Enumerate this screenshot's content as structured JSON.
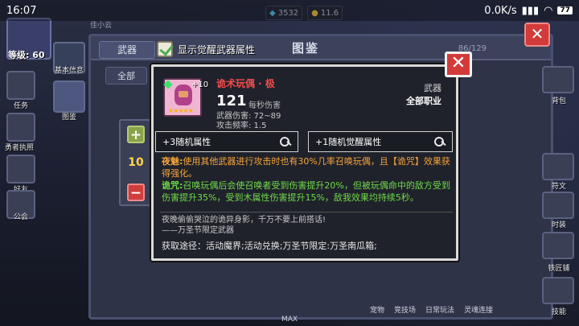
{
  "status_bar": {
    "time": "16:07",
    "network_speed": "0.0K/s",
    "battery": "77"
  },
  "hud": {
    "level_label": "等级: 60",
    "player_name": "佳小云",
    "gem_count": "3532",
    "coin_count": "11.6"
  },
  "left_nav": {
    "items": [
      {
        "label": "任务"
      },
      {
        "label": "勇者执照"
      },
      {
        "label": "好友"
      },
      {
        "label": "公会"
      }
    ],
    "tabs": [
      {
        "label": "基本信息"
      },
      {
        "label": "图鉴"
      }
    ]
  },
  "panel": {
    "title": "图鉴",
    "tab_weapon": "武器",
    "count": "86/129",
    "filter_all": "全部"
  },
  "awaken_toggle": {
    "label": "显示觉醒武器属性",
    "checked": true
  },
  "stepper": {
    "value": "10"
  },
  "weapon": {
    "name": "诡术玩偶 · 极",
    "enhance": "+10",
    "dps": "121",
    "dps_label": "每秒伤害",
    "damage": "武器伤害: 72~89",
    "attack_rate": "攻击频率: 1.5",
    "type": "武器",
    "class": "全部职业",
    "stars": "★★★★★"
  },
  "attributes": {
    "random": "+3随机属性",
    "awaken_random": "+1随机觉醒属性"
  },
  "description": {
    "line1_tag": "夜魅:",
    "line1_text": "使用其他武器进行攻击时也有30%几率召唤玩偶，且【诡咒】效果获得强化。",
    "line2_tag": "诡咒:",
    "line2_text": "召唤玩偶后会使召唤者受到伤害提升20%，但被玩偶命中的敌方受到伤害提升35%，受到木属性伤害提升15%，敌我效果均持续5秒。"
  },
  "flavor": {
    "line1": "夜晚偷偷哭泣的诡异身影，千万不要上前搭话!",
    "line2": "——万圣节限定武器"
  },
  "source": "获取途径：活动魔界;活动兑换;万圣节限定:万圣南瓜箱;",
  "right_nav": [
    {
      "label": "背包"
    },
    {
      "label": "符文"
    },
    {
      "label": "时装"
    },
    {
      "label": "铁匠铺"
    },
    {
      "label": "技能"
    }
  ],
  "bottom_bar": [
    "宠物",
    "竞技场",
    "日常玩法",
    "灵魂连接"
  ],
  "max_label": "MAX",
  "colors": {
    "close_red": "#d33b3b",
    "name_red": "#f24b4b",
    "orange_effect": "#f6a53a",
    "green_effect": "#6fdc49"
  }
}
